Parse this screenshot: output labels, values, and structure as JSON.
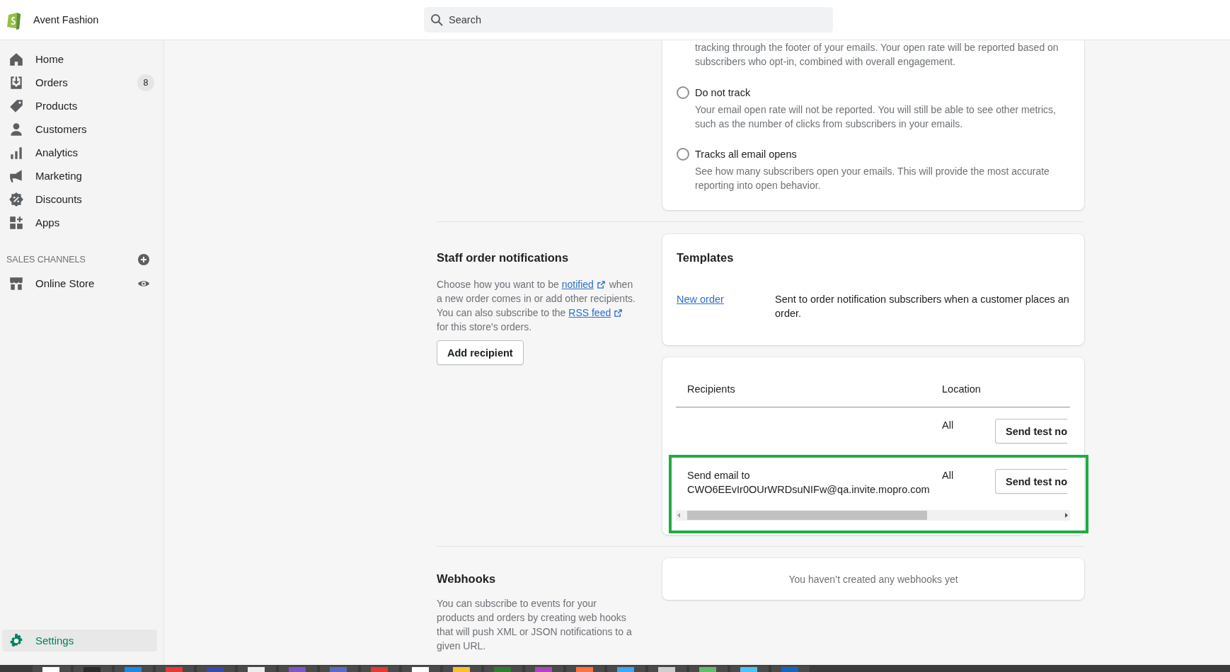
{
  "store": {
    "name": "Avent Fashion"
  },
  "search": {
    "placeholder": "Search"
  },
  "nav": [
    {
      "label": "Home",
      "selected": false
    },
    {
      "label": "Orders",
      "badge": "8",
      "selected": false
    },
    {
      "label": "Products",
      "selected": false
    },
    {
      "label": "Customers",
      "selected": false
    },
    {
      "label": "Analytics",
      "selected": false
    },
    {
      "label": "Marketing",
      "selected": false
    },
    {
      "label": "Discounts",
      "selected": false
    },
    {
      "label": "Apps",
      "selected": false
    }
  ],
  "sales_channels": {
    "heading": "SALES CHANNELS",
    "items": [
      {
        "label": "Online Store",
        "selected": false
      }
    ]
  },
  "settings": {
    "label": "Settings",
    "selected": true
  },
  "open_tracking": {
    "intro": "tracking through the footer of your emails. Your open rate will be reported based on subscribers who opt-in, combined with overall engagement.",
    "options": [
      {
        "label": "Do not track",
        "description": "Your email open rate will not be reported. You will still be able to see other metrics, such as the number of clicks from subscribers in your emails.",
        "selected": false
      },
      {
        "label": "Tracks all email opens",
        "description": "See how many subscribers open your emails. This will provide the most accurate reporting into open behavior.",
        "selected": false
      }
    ]
  },
  "staff": {
    "title": "Staff order notifications",
    "description": [
      {
        "kind": "text",
        "text": "Choose how you want to be "
      },
      {
        "kind": "link",
        "text": "notified"
      },
      {
        "kind": "text",
        "text": " when a new order comes in or add other recipients. You can also subscribe to the "
      },
      {
        "kind": "link",
        "text": "RSS feed"
      },
      {
        "kind": "text",
        "text": " for this store's orders."
      }
    ],
    "button": "Add recipient"
  },
  "templates": {
    "title": "Templates",
    "rows": [
      {
        "name": "New order",
        "description": "Sent to order notification subscribers when a customer places an order."
      }
    ]
  },
  "recipients": {
    "columns": [
      "Recipients",
      "Location"
    ],
    "rows": [
      {
        "location": "All",
        "button": "Send test no",
        "highlighted": false
      },
      {
        "recipient_prefix": "Send email to",
        "recipient_email": "CWO6EEvIr0OUrWRDsuNIFw@qa.invite.mopro.com",
        "location": "All",
        "button": "Send test no",
        "highlighted": true
      }
    ]
  },
  "webhooks": {
    "title": "Webhooks",
    "description": "You can subscribe to events for your products and orders by creating web hooks that will push XML or JSON notifications to a given URL.",
    "empty_message": "You haven’t created any webhooks yet"
  }
}
